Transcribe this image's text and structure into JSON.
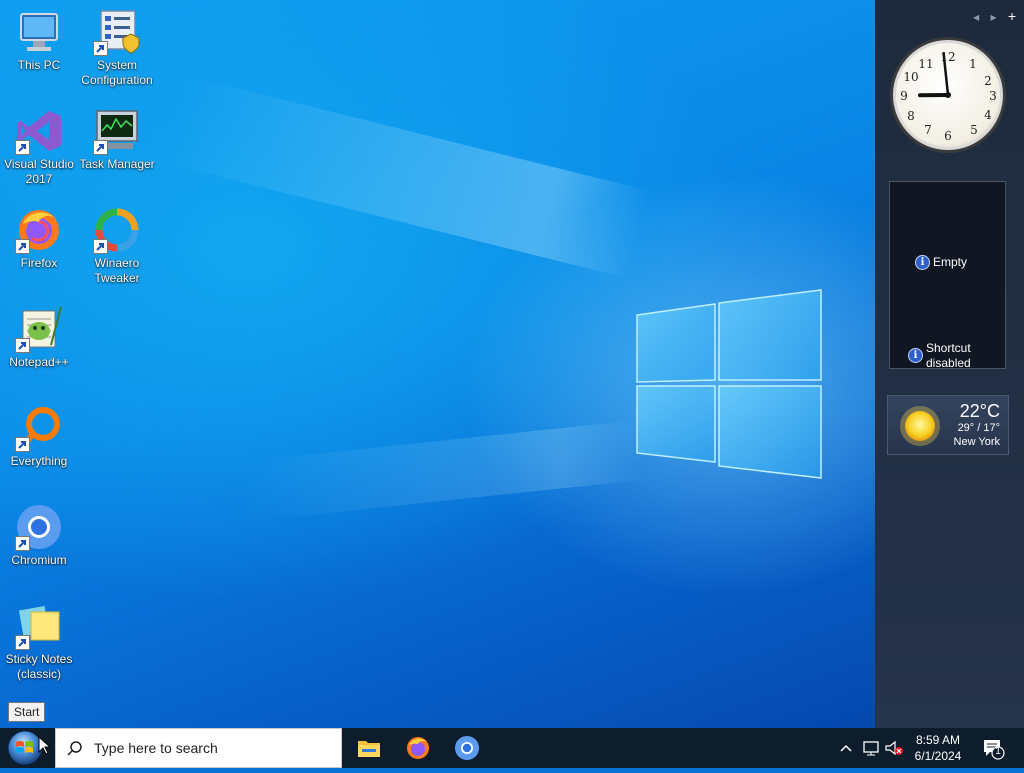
{
  "desktop": {
    "icons": [
      {
        "label_lines": [
          "This PC"
        ],
        "icon": "this-pc-icon"
      },
      {
        "label_lines": [
          "System",
          "Configuration"
        ],
        "icon": "system-configuration-icon"
      },
      {
        "label_lines": [
          "Visual Studio",
          "2017"
        ],
        "icon": "visual-studio-icon"
      },
      {
        "label_lines": [
          "Task Manager"
        ],
        "icon": "task-manager-icon"
      },
      {
        "label_lines": [
          "Firefox"
        ],
        "icon": "firefox-icon"
      },
      {
        "label_lines": [
          "Winaero",
          "Tweaker"
        ],
        "icon": "winaero-tweaker-icon"
      },
      {
        "label_lines": [
          "Notepad++"
        ],
        "icon": "notepad-plus-plus-icon"
      },
      {
        "label_lines": [
          "Everything"
        ],
        "icon": "everything-icon"
      },
      {
        "label_lines": [
          "Chromium"
        ],
        "icon": "chromium-icon"
      },
      {
        "label_lines": [
          "Sticky Notes",
          "(classic)"
        ],
        "icon": "sticky-notes-icon"
      }
    ]
  },
  "sidebar": {
    "nav": {
      "prev": "◂",
      "next": "▸",
      "add": "+"
    },
    "clock": {
      "hour": 8,
      "minute": 59
    },
    "slideshow": {
      "empty": "Empty",
      "shortcut": [
        "Shortcut",
        "disabled"
      ]
    },
    "weather": {
      "temp": "22°C",
      "range": "29° / 17°",
      "city": "New York"
    }
  },
  "tooltip": "Start",
  "taskbar": {
    "search_placeholder": "Type here to search",
    "apps": [
      "file-explorer-icon",
      "firefox-icon",
      "chromium-icon"
    ],
    "time": "8:59 AM",
    "date": "6/1/2024",
    "notification_count": "1"
  },
  "colors": {
    "taskbar": "#0e1d2c",
    "sidebar": "#222f44",
    "wallpaper": "#0a86e6"
  }
}
